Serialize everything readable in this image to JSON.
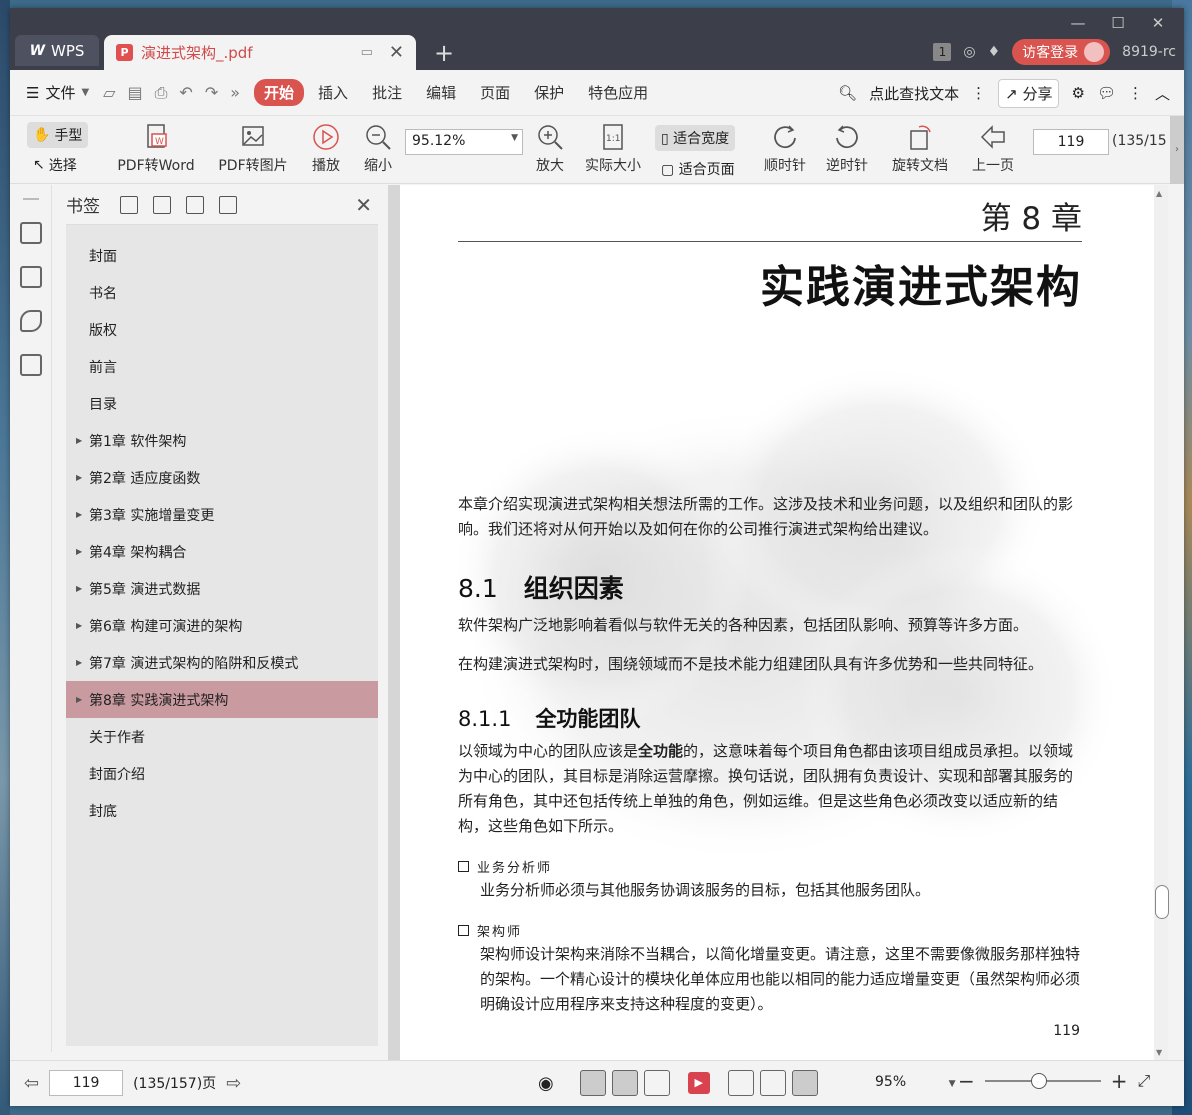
{
  "titlebar": {
    "app_tab": "WPS",
    "doc_tab": "演进式架构_.pdf",
    "tab_count": "1",
    "visitor_login": "访客登录",
    "version": "8919-rc"
  },
  "menubar": {
    "file": "文件",
    "tabs": [
      "开始",
      "插入",
      "批注",
      "编辑",
      "页面",
      "保护",
      "特色应用"
    ],
    "search": "点此查找文本",
    "share": "分享"
  },
  "toolbar": {
    "hand": "手型",
    "select": "选择",
    "pdf_to_word": "PDF转Word",
    "pdf_to_image": "PDF转图片",
    "play": "播放",
    "zoom_out": "缩小",
    "zoom_value": "95.12%",
    "zoom_in": "放大",
    "actual_size": "实际大小",
    "fit_width": "适合宽度",
    "fit_page": "适合页面",
    "clockwise": "顺时针",
    "counter_clockwise": "逆时针",
    "rotate_doc": "旋转文档",
    "prev_page": "上一页",
    "page_input": "119",
    "page_of": "(135/15"
  },
  "bookmarks": {
    "title": "书签",
    "items": [
      {
        "label": "封面",
        "expandable": false
      },
      {
        "label": "书名",
        "expandable": false
      },
      {
        "label": "版权",
        "expandable": false
      },
      {
        "label": "前言",
        "expandable": false
      },
      {
        "label": "目录",
        "expandable": false
      },
      {
        "label": "第1章  软件架构",
        "expandable": true
      },
      {
        "label": "第2章  适应度函数",
        "expandable": true
      },
      {
        "label": "第3章  实施增量变更",
        "expandable": true
      },
      {
        "label": "第4章  架构耦合",
        "expandable": true
      },
      {
        "label": "第5章  演进式数据",
        "expandable": true
      },
      {
        "label": "第6章  构建可演进的架构",
        "expandable": true
      },
      {
        "label": "第7章  演进式架构的陷阱和反模式",
        "expandable": true
      },
      {
        "label": "第8章  实践演进式架构",
        "expandable": true,
        "active": true
      },
      {
        "label": "关于作者",
        "expandable": false
      },
      {
        "label": "封面介绍",
        "expandable": false
      },
      {
        "label": "封底",
        "expandable": false
      }
    ]
  },
  "page": {
    "chapter_num": "第 8 章",
    "chapter_title": "实践演进式架构",
    "intro": "本章介绍实现演进式架构相关想法所需的工作。这涉及技术和业务问题，以及组织和团队的影响。我们还将对从何开始以及如何在你的公司推行演进式架构给出建议。",
    "s81_num": "8.1",
    "s81_title": "组织因素",
    "s81_p1": "软件架构广泛地影响着看似与软件无关的各种因素，包括团队影响、预算等许多方面。",
    "s81_p2": "在构建演进式架构时，围绕领域而不是技术能力组建团队具有许多优势和一些共同特征。",
    "s811_num": "8.1.1",
    "s811_title": "全功能团队",
    "s811_p1_a": "以领域为中心的团队应该是",
    "s811_p1_b": "全功能",
    "s811_p1_c": "的，这意味着每个项目角色都由该项目组成员承担。以领域为中心的团队，其目标是消除运营摩擦。换句话说，团队拥有负责设计、实现和部署其服务的所有角色，其中还包括传统上单独的角色，例如运维。但是这些角色必须改变以适应新的结构，这些角色如下所示。",
    "b1_title": "业务分析师",
    "b1_text": "业务分析师必须与其他服务协调该服务的目标，包括其他服务团队。",
    "b2_title": "架构师",
    "b2_text": "架构师设计架构来消除不当耦合，以简化增量变更。请注意，这里不需要像微服务那样独特的架构。一个精心设计的模块化单体应用也能以相同的能力适应增量变更（虽然架构师必须明确设计应用程序来支持这种程度的变更）。",
    "page_number": "119"
  },
  "statusbar": {
    "page_input": "119",
    "page_of": "(135/157)页",
    "zoom": "95%"
  }
}
